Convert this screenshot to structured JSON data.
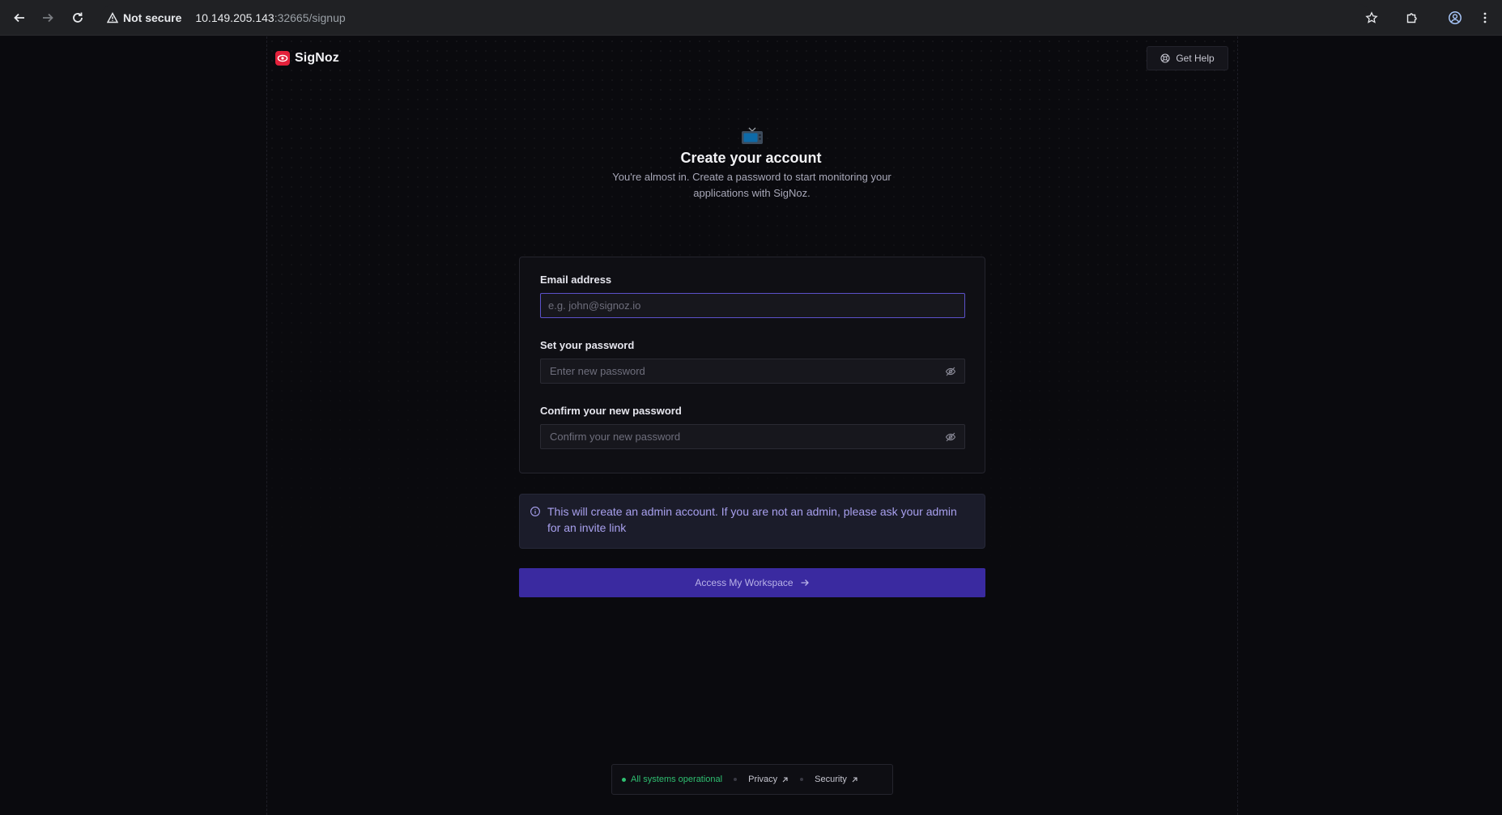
{
  "browser": {
    "security_label": "Not secure",
    "url_host": "10.149.205.143",
    "url_rest": ":32665/signup"
  },
  "header": {
    "brand_name": "SigNoz",
    "help_label": "Get Help"
  },
  "hero": {
    "title": "Create your account",
    "subtitle": "You're almost in. Create a password to start monitoring your applications with SigNoz."
  },
  "form": {
    "email_label": "Email address",
    "email_placeholder": "e.g. john@signoz.io",
    "email_value": "",
    "password_label": "Set your password",
    "password_placeholder": "Enter new password",
    "password_value": "",
    "confirm_label": "Confirm your new password",
    "confirm_placeholder": "Confirm your new password",
    "confirm_value": ""
  },
  "notice": {
    "text": "This will create an admin account. If you are not an admin, please ask your admin for an invite link"
  },
  "cta": {
    "label": "Access My Workspace"
  },
  "footer": {
    "status": "All systems operational",
    "privacy": "Privacy",
    "security": "Security"
  },
  "colors": {
    "accent": "#3a2aa0",
    "brand": "#e3213b",
    "status_ok": "#2fbf71",
    "notice_text": "#a8a0ee"
  }
}
